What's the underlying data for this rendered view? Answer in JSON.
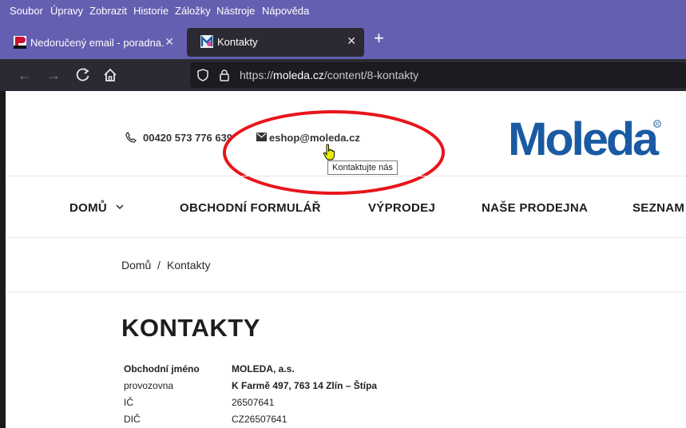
{
  "menu": [
    "Soubor",
    "Úpravy",
    "Zobrazit",
    "Historie",
    "Záložky",
    "Nástroje",
    "Nápověda"
  ],
  "tabs": [
    {
      "title": "Nedoručený email - poradna.ne"
    },
    {
      "title": "Kontakty"
    }
  ],
  "url": {
    "prefix": "https://",
    "host": "moleda.cz",
    "path": "/content/8-kontakty"
  },
  "header": {
    "phone": "00420 573 776 639",
    "email": "eshop@moleda.cz",
    "tooltip": "Kontaktujte nás",
    "logo_text": "Moleda"
  },
  "colors": {
    "brand_blue": "#1a5aa3",
    "annotation_red": "#e8141b",
    "browser_purple": "#645fb0"
  },
  "nav": [
    "DOMŮ",
    "OBCHODNÍ FORMULÁŘ",
    "VÝPRODEJ",
    "NAŠE PRODEJNA",
    "SEZNAM"
  ],
  "breadcrumb": {
    "home": "Domů",
    "separator": "/",
    "current": "Kontakty"
  },
  "heading": "KONTAKTY",
  "details": [
    {
      "label": "Obchodní jméno",
      "value": "MOLEDA, a.s."
    },
    {
      "label": "provozovna",
      "value": "K Farmě 497, 763 14 Zlín – Štípa"
    },
    {
      "label": "IČ",
      "value": "26507641"
    },
    {
      "label": "DIČ",
      "value": "CZ26507641"
    }
  ]
}
